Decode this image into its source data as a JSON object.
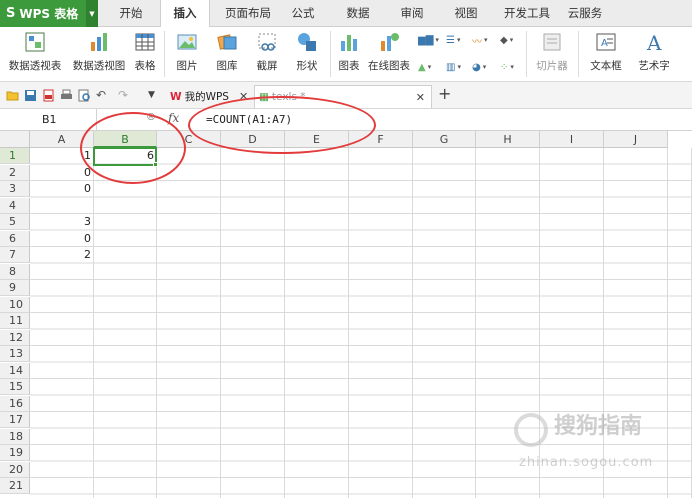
{
  "app": {
    "name": "WPS 表格",
    "logo": "S"
  },
  "menu": {
    "tabs": [
      "开始",
      "插入",
      "页面布局",
      "公式",
      "数据",
      "审阅",
      "视图",
      "开发工具",
      "云服务"
    ],
    "active": "插入"
  },
  "ribbon": {
    "buttons": {
      "pivot_table": "数据透视表",
      "pivot_chart": "数据透视图",
      "table": "表格",
      "picture": "图片",
      "gallery": "图库",
      "screenshot": "截屏",
      "shapes": "形状",
      "chart": "图表",
      "online_chart": "在线图表",
      "slicer": "切片器",
      "textbox": "文本框",
      "wordart": "艺术字"
    }
  },
  "tabs_bar": {
    "wps_tab": "我的WPS",
    "doc_tab": "texls *"
  },
  "formula_bar": {
    "cell_ref": "B1",
    "fx": "fx",
    "formula": "=COUNT(A1:A7)"
  },
  "sheet": {
    "columns": [
      "A",
      "B",
      "C",
      "D",
      "E",
      "F",
      "G",
      "H",
      "I",
      "J"
    ],
    "rows": [
      "1",
      "2",
      "3",
      "4",
      "5",
      "6",
      "7",
      "8",
      "9",
      "10",
      "11",
      "12",
      "13",
      "14",
      "15",
      "16",
      "17",
      "18",
      "19",
      "20",
      "21"
    ],
    "selected_column": "B",
    "selected_row": "1",
    "cells": {
      "A1": "1",
      "A2": "0",
      "A3": "0",
      "A5": "3",
      "A6": "0",
      "A7": "2",
      "B1": "6"
    }
  },
  "colors": {
    "accent_green": "#3c9a3c",
    "annotation_red": "#e23b3b"
  },
  "watermark": {
    "text": "搜狗指南",
    "sub": "zhinan.sogou.com"
  }
}
